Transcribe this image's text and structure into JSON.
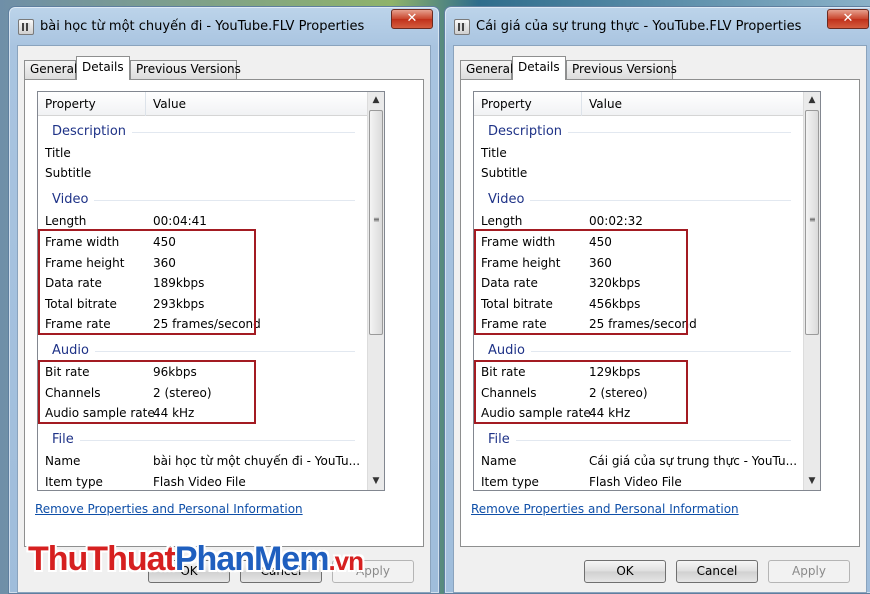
{
  "windows": [
    {
      "title": "bài học từ một chuyến đi - YouTube.FLV Properties",
      "close_glyph": "✕",
      "tabs": [
        "General",
        "Details",
        "Previous Versions"
      ],
      "active_tab": "Details",
      "columns": {
        "property": "Property",
        "value": "Value"
      },
      "groups": {
        "description": "Description",
        "video": "Video",
        "audio": "Audio",
        "file": "File"
      },
      "description": [
        {
          "property": "Title",
          "value": ""
        },
        {
          "property": "Subtitle",
          "value": ""
        }
      ],
      "video": [
        {
          "property": "Length",
          "value": "00:04:41"
        },
        {
          "property": "Frame width",
          "value": "450"
        },
        {
          "property": "Frame height",
          "value": "360"
        },
        {
          "property": "Data rate",
          "value": "189kbps"
        },
        {
          "property": "Total bitrate",
          "value": "293kbps"
        },
        {
          "property": "Frame rate",
          "value": "25 frames/second"
        }
      ],
      "audio": [
        {
          "property": "Bit rate",
          "value": "96kbps"
        },
        {
          "property": "Channels",
          "value": "2 (stereo)"
        },
        {
          "property": "Audio sample rate",
          "value": "44 kHz"
        }
      ],
      "file": [
        {
          "property": "Name",
          "value": "bài học từ một chuyến đi - YouTu..."
        },
        {
          "property": "Item type",
          "value": "Flash Video File"
        }
      ],
      "remove_link": "Remove Properties and Personal Information",
      "buttons": {
        "ok": "OK",
        "cancel": "Cancel",
        "apply": "Apply"
      }
    },
    {
      "title": "Cái giá của sự trung thực - YouTube.FLV Properties",
      "close_glyph": "✕",
      "tabs": [
        "General",
        "Details",
        "Previous Versions"
      ],
      "active_tab": "Details",
      "columns": {
        "property": "Property",
        "value": "Value"
      },
      "groups": {
        "description": "Description",
        "video": "Video",
        "audio": "Audio",
        "file": "File"
      },
      "description": [
        {
          "property": "Title",
          "value": ""
        },
        {
          "property": "Subtitle",
          "value": ""
        }
      ],
      "video": [
        {
          "property": "Length",
          "value": "00:02:32"
        },
        {
          "property": "Frame width",
          "value": "450"
        },
        {
          "property": "Frame height",
          "value": "360"
        },
        {
          "property": "Data rate",
          "value": "320kbps"
        },
        {
          "property": "Total bitrate",
          "value": "456kbps"
        },
        {
          "property": "Frame rate",
          "value": "25 frames/second"
        }
      ],
      "audio": [
        {
          "property": "Bit rate",
          "value": "129kbps"
        },
        {
          "property": "Channels",
          "value": "2 (stereo)"
        },
        {
          "property": "Audio sample rate",
          "value": "44 kHz"
        }
      ],
      "file": [
        {
          "property": "Name",
          "value": "Cái giá của sự trung thực - YouTu..."
        },
        {
          "property": "Item type",
          "value": "Flash Video File"
        }
      ],
      "remove_link": "Remove Properties and Personal Information",
      "buttons": {
        "ok": "OK",
        "cancel": "Cancel",
        "apply": "Apply"
      }
    }
  ],
  "watermark": {
    "part1": "ThuThuat",
    "part2": "PhanMem",
    "part3": ".vn"
  },
  "colors": {
    "highlight_border": "#a31b22",
    "group_header": "#1e3287",
    "link": "#0f4fa8",
    "close_button": "#c9452c"
  },
  "icons": {
    "window": "video-file-icon",
    "close": "close-icon",
    "scroll_up": "scroll-up-arrow-icon",
    "scroll_down": "scroll-down-arrow-icon"
  }
}
